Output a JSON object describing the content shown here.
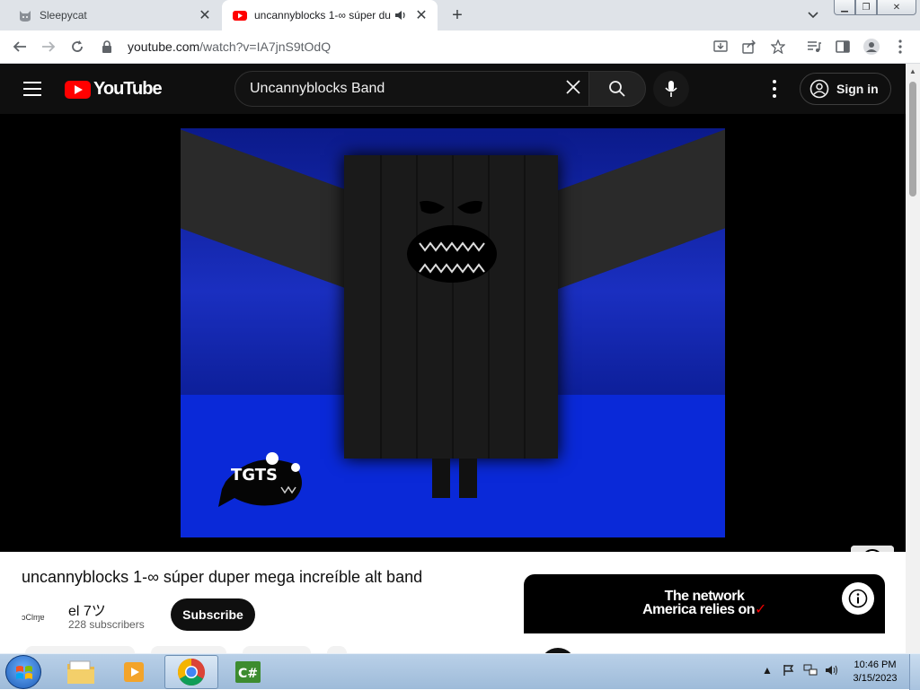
{
  "browser": {
    "tabs": [
      {
        "title": "Sleepycat",
        "favicon": "cat-icon",
        "active": false
      },
      {
        "title": "uncannyblocks 1-∞ súper du",
        "favicon": "youtube-icon",
        "active": true,
        "audio": true
      }
    ],
    "url_host": "youtube.com",
    "url_path": "/watch?v=IA7jnS9tOdQ"
  },
  "youtube": {
    "logo_text": "YouTube",
    "search_value": "Uncannyblocks Band",
    "signin_label": "Sign in",
    "video_overlay_text": "TGTS",
    "video_title": "uncannyblocks 1-∞ súper duper mega increíble alt band",
    "channel_name": "el 7ツ",
    "channel_avatar_text": "ɔClɱɐ",
    "subscribers": "228 subscribers",
    "subscribe_label": "Subscribe",
    "ad": {
      "line1": "The network",
      "line2": "America relies on",
      "check": "✓"
    }
  },
  "taskbar": {
    "time": "10:46 PM",
    "date": "3/15/2023",
    "apps": [
      "explorer",
      "media-player",
      "chrome",
      "csharp"
    ],
    "active_app": "chrome"
  },
  "colors": {
    "yt_red": "#ff0000",
    "yt_dark": "#0f0f0f",
    "video_blue": "#0a29d8"
  }
}
